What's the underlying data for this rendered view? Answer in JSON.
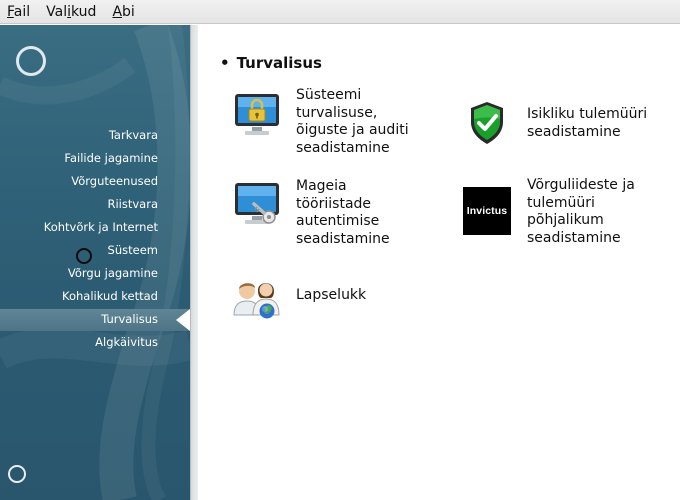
{
  "menubar": {
    "items": [
      {
        "label": "Fail",
        "mnemonic": "F",
        "rest": "ail"
      },
      {
        "label": "Valikud",
        "mnemonic_prefix": "Val",
        "mnemonic": "i",
        "rest": "kud"
      },
      {
        "label": "Abi",
        "mnemonic": "A",
        "rest": "bi"
      }
    ]
  },
  "sidebar": {
    "selected_index": 8,
    "items": [
      {
        "label": "Tarkvara"
      },
      {
        "label": "Failide jagamine"
      },
      {
        "label": "Võrguteenused"
      },
      {
        "label": "Riistvara"
      },
      {
        "label": "Kohtvõrk ja Internet"
      },
      {
        "label": "Süsteem"
      },
      {
        "label": "Võrgu jagamine"
      },
      {
        "label": "Kohalikud kettad"
      },
      {
        "label": "Turvalisus"
      },
      {
        "label": "Algkäivitus"
      }
    ]
  },
  "content": {
    "section_title": "Turvalisus",
    "tools": [
      {
        "label": "Süsteemi\nturvalisuse,\nõiguste ja auditi\nseadistamine",
        "icon": "monitor-lock-icon"
      },
      {
        "label": "Isikliku tulemüüri\nseadistamine",
        "icon": "shield-check-icon"
      },
      {
        "label": "Mageia\ntööriistade\nautentimise\nseadistamine",
        "icon": "monitor-key-icon"
      },
      {
        "label": "Võrguliideste ja\ntulemüüri\npõhjalikum\nseadistamine",
        "icon": "invictus-logo-icon",
        "icon_text": "Invictus"
      },
      {
        "label": "Lapselukk",
        "icon": "parental-users-icon"
      }
    ]
  },
  "colors": {
    "sidebar_bg": "#2f6178",
    "sidebar_text": "#ffffff",
    "selected_bg": "#557c8e",
    "shield_green": "#19a02a"
  }
}
